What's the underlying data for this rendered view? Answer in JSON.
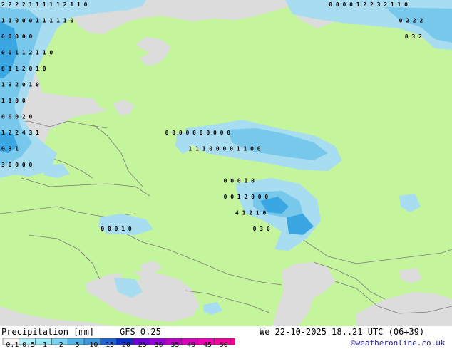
{
  "map": {
    "colors": {
      "land": "#c4f59c",
      "sea": "#dcdcdc",
      "unmodeled_land": "#dcdcdc",
      "precip_light": "#a8dcf0",
      "precip_mid": "#78c8ec",
      "precip_heavy": "#3aa6e2"
    },
    "grid_labels": [
      {
        "col": 0,
        "row": 0,
        "text": "2 2 2 2 1 1 1 1 1 2 1 1 0"
      },
      {
        "col": 0,
        "row": 1,
        "text": "1 1 0 0 0 1 1 1 1 1 0"
      },
      {
        "col": 0,
        "row": 2,
        "text": "0 0 0 0 0"
      },
      {
        "col": 0,
        "row": 3,
        "text": "0 0 1 1 2 1 1 0"
      },
      {
        "col": 0,
        "row": 4,
        "text": "0 1 1 2 0 1 0"
      },
      {
        "col": 0,
        "row": 5,
        "text": "1 3 2 0 1 0"
      },
      {
        "col": 0,
        "row": 6,
        "text": "1 1 0 0"
      },
      {
        "col": 0,
        "row": 7,
        "text": "0 0 0 2 0"
      },
      {
        "col": 0,
        "row": 8,
        "text": "1 2 2 4 3 1"
      },
      {
        "col": 0,
        "row": 9,
        "text": "0 3 1"
      },
      {
        "col": 0,
        "row": 10,
        "text": "3 0 0   0 0"
      },
      {
        "col": 28,
        "row": 8,
        "text": "0 0 0 0   0 0 0 0 0 0"
      },
      {
        "col": 32,
        "row": 9,
        "text": "1 1 1 0 0 0 0 1 1 0 0"
      },
      {
        "col": 38,
        "row": 11,
        "text": "0 0 0 1 0"
      },
      {
        "col": 38,
        "row": 12,
        "text": "0 0 1 2 0 0 0"
      },
      {
        "col": 40,
        "row": 13,
        "text": "4 1 2 1 0"
      },
      {
        "col": 43,
        "row": 14,
        "text": "0 3 0"
      },
      {
        "col": 17,
        "row": 14,
        "text": "0 0 0 1 0"
      },
      {
        "col": 56,
        "row": 0,
        "text": "0 0 0   0 1 2 2 3 2 1 1 0"
      },
      {
        "col": 68,
        "row": 1,
        "text": "0 2 2 2"
      },
      {
        "col": 69,
        "row": 2,
        "text": "0 3 2"
      }
    ]
  },
  "footer": {
    "title": "Precipitation [mm]",
    "model": "GFS 0.25",
    "datetime": "We 22-10-2025 18..21 UTC (06+39)",
    "credit": "©weatheronline.co.uk",
    "legend": {
      "ticks": [
        "0.1",
        "0.5",
        "1",
        "2",
        "5",
        "10",
        "15",
        "20",
        "25",
        "30",
        "35",
        "40",
        "45",
        "50"
      ],
      "colors": [
        "#f5f5f5",
        "#b4f0fa",
        "#96e6f5",
        "#78d2f0",
        "#50b4e6",
        "#3c96dc",
        "#1e64d2",
        "#0a32c8",
        "#6e00dc",
        "#9600dc",
        "#be00c8",
        "#dc00be",
        "#f000b4",
        "#fa00a0",
        "#ff0096"
      ]
    }
  }
}
